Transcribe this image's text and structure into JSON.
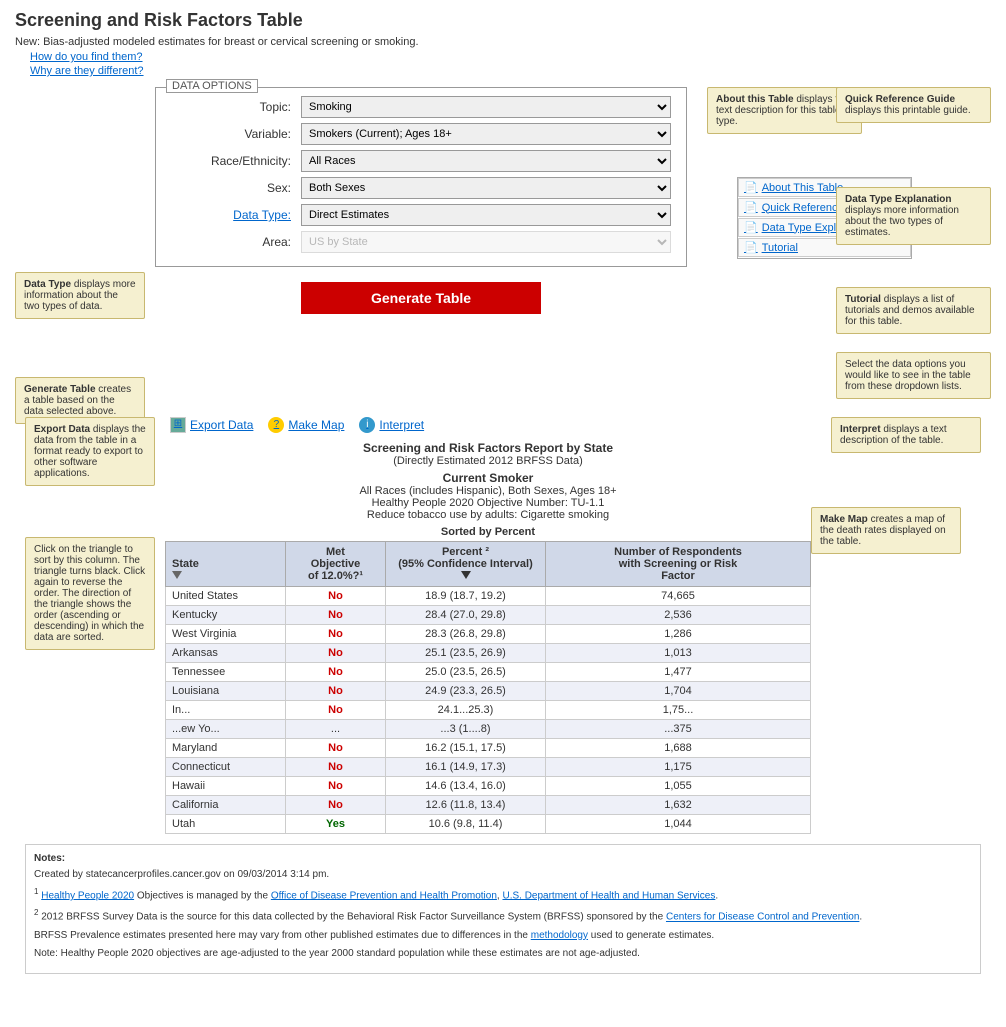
{
  "page": {
    "title": "Screening and Risk Factors Table",
    "subtitle": "New: Bias-adjusted modeled estimates for breast or cervical screening or smoking.",
    "links": [
      "How do you find them?",
      "Why are they different?"
    ]
  },
  "dataOptions": {
    "title": "Data Options",
    "fields": [
      {
        "label": "Topic:",
        "value": "Smoking",
        "type": "select"
      },
      {
        "label": "Variable:",
        "value": "Smokers (Current); Ages 18+",
        "type": "select"
      },
      {
        "label": "Race/Ethnicity:",
        "value": "All Races",
        "type": "select"
      },
      {
        "label": "Sex:",
        "value": "Both Sexes",
        "type": "select"
      },
      {
        "label": "Data Type:",
        "value": "Direct Estimates",
        "type": "select",
        "isLink": true
      },
      {
        "label": "Area:",
        "value": "US by State",
        "type": "select-disabled"
      }
    ],
    "generateButton": "Generate Table"
  },
  "navLinks": [
    {
      "label": "About This Table",
      "icon": "📄"
    },
    {
      "label": "Quick Reference Guide",
      "icon": "📄"
    },
    {
      "label": "Data Type Explanation",
      "icon": "📄"
    },
    {
      "label": "Tutorial",
      "icon": "📄"
    }
  ],
  "tooltips": {
    "aboutTable": {
      "title": "About this Table",
      "text": "displays the text description for this table type."
    },
    "quickRef": {
      "title": "Quick Reference Guide",
      "text": "displays this printable guide."
    },
    "dataTypeExp": {
      "title": "Data Type Explanation",
      "text": "displays more information about the two types of estimates."
    },
    "tutorial": {
      "title": "Tutorial",
      "text": "displays a list of tutorials and demos available for this table."
    },
    "dataType": {
      "title": "Data Type",
      "text": "displays more information about the two types of data."
    },
    "generateTable": {
      "title": "Generate Table",
      "text": "creates a table based on the data selected above."
    },
    "exportData": {
      "title": "Export Data",
      "text": "displays the data from the table in a format ready to export to other software applications."
    },
    "makeMap": {
      "title": "Make Map",
      "text": "creates a map of the death rates displayed on the table."
    },
    "interpret": {
      "title": "Interpret",
      "text": "displays a text description of the table."
    },
    "sortColumn": {
      "text": "Click on the triangle to sort by this column. The triangle turns black. Click again to reverse the order. The direction of the triangle shows the order (ascending or descending) in which the data are sorted."
    },
    "selectData": {
      "text": "Select the data options you would like to see in the table from these dropdown lists."
    }
  },
  "tableInfo": {
    "title": "Screening and Risk Factors Report by State",
    "subtitle": "(Directly Estimated 2012 BRFSS Data)",
    "currentLabel": "Current Smoker",
    "demographics": "All Races (includes Hispanic), Both Sexes, Ages 18+",
    "objective": "Healthy People 2020 Objective Number: TU-1.1",
    "objectiveDesc": "Reduce tobacco use by adults: Cigarette smoking",
    "sortedBy": "Sorted by Percent"
  },
  "toolbar": {
    "exportData": "Export Data",
    "makeMap": "Make Map",
    "interpret": "Interpret"
  },
  "tableColumns": [
    "State",
    "Met Objective of 12.0%?¹",
    "Percent ² (95% Confidence Interval)",
    "Number of Respondents with Screening or Risk Factor"
  ],
  "tableRows": [
    {
      "state": "United States",
      "met": "No",
      "percent": "18.9 (18.7, 19.2)",
      "number": "74,665"
    },
    {
      "state": "Kentucky",
      "met": "No",
      "percent": "28.4 (27.0, 29.8)",
      "number": "2,536"
    },
    {
      "state": "West Virginia",
      "met": "No",
      "percent": "28.3 (26.8, 29.8)",
      "number": "1,286"
    },
    {
      "state": "Arkansas",
      "met": "No",
      "percent": "25.1 (23.5, 26.9)",
      "number": "1,013"
    },
    {
      "state": "Tennessee",
      "met": "No",
      "percent": "25.0 (23.5, 26.5)",
      "number": "1,477"
    },
    {
      "state": "Louisiana",
      "met": "No",
      "percent": "24.9 (23.3, 26.5)",
      "number": "1,704"
    },
    {
      "state": "In...",
      "met": "No",
      "percent": "24.1...25.3)",
      "number": "1,75...",
      "diag": true
    },
    {
      "state": "...ew Yo...",
      "met": "...",
      "percent": "...3 (1....8)",
      "number": "...375",
      "diag": true
    },
    {
      "state": "Maryland",
      "met": "No",
      "percent": "16.2 (15.1, 17.5)",
      "number": "1,688"
    },
    {
      "state": "Connecticut",
      "met": "No",
      "percent": "16.1 (14.9, 17.3)",
      "number": "1,175"
    },
    {
      "state": "Hawaii",
      "met": "No",
      "percent": "14.6 (13.4, 16.0)",
      "number": "1,055"
    },
    {
      "state": "California",
      "met": "No",
      "percent": "12.6 (11.8, 13.4)",
      "number": "1,632"
    },
    {
      "state": "Utah",
      "met": "Yes",
      "percent": "10.6 (9.8, 11.4)",
      "number": "1,044"
    }
  ],
  "notes": {
    "title": "Notes:",
    "created": "Created by statecancerprofiles.cancer.gov on 09/03/2014 3:14 pm.",
    "note1": "Healthy People 2020 Objectives is managed by the Office of Disease Prevention and Health Promotion, U.S. Department of Health and Human Services.",
    "note2": "2012 BRFSS Survey Data is the source for this data collected by the Behavioral Risk Factor Surveillance System (BRFSS) sponsored by the Centers for Disease Control and Prevention.",
    "note3": "BRFSS Prevalence estimates presented here may vary from other published estimates due to differences in the methodology used to generate estimates.",
    "note4": "Note: Healthy People 2020 objectives are age-adjusted to the year 2000 standard population while these estimates are not age-adjusted."
  }
}
